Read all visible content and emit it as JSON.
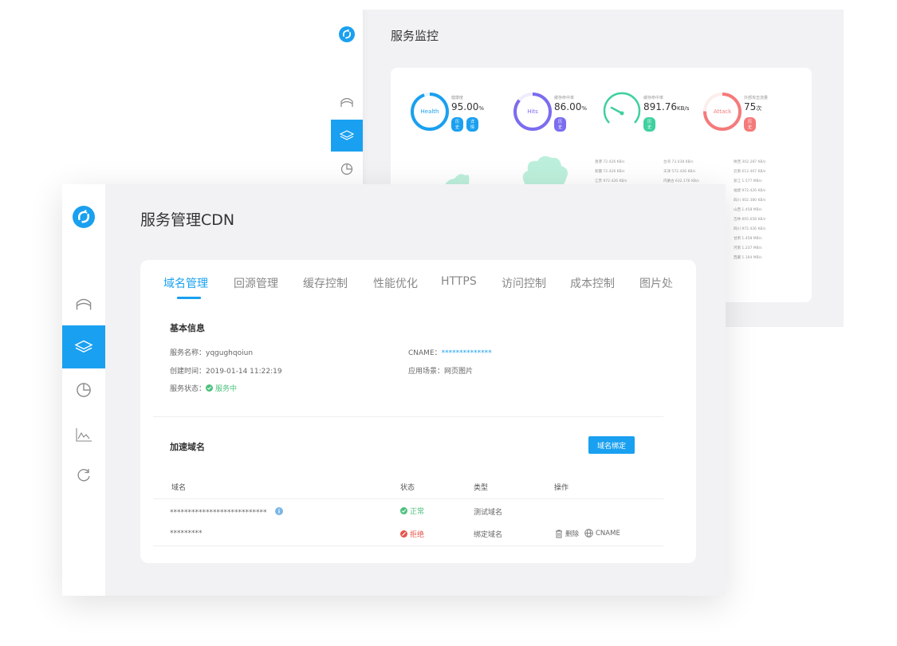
{
  "colors": {
    "accent": "#1aa0f0",
    "health": "#1aa0f0",
    "hits": "#7b6cf0",
    "speed": "#3fd0a0",
    "attack": "#f57a7a",
    "ok": "#4cc17d",
    "reject": "#e5564c"
  },
  "monitor": {
    "title": "服务监控",
    "metrics": [
      {
        "ring_label": "Health",
        "caption": "健康度",
        "value": "95.00",
        "unit": "%",
        "tags": [
          "历史",
          "详情"
        ]
      },
      {
        "ring_label": "Hits",
        "caption": "缓存命中率",
        "value": "86.00",
        "unit": "%",
        "tags": [
          "历史"
        ]
      },
      {
        "ring_label": "",
        "caption": "缓存命中率",
        "value": "891.76",
        "unit": "KB/s",
        "tags": [
          "历史"
        ]
      },
      {
        "ring_label": "Attack",
        "caption": "外部攻击流量",
        "value": "75",
        "unit": "次",
        "tags": [
          "历史"
        ]
      }
    ],
    "speeds_col1": [
      "香港 72.426 KB/s",
      "新疆 72.426 KB/s",
      "江苏 972.426 KB/s"
    ],
    "speeds_col2": [
      "台湾 73.038 KB/s",
      "天津 572.426 KB/s",
      "内蒙古 632.176 KB/s"
    ],
    "speeds_col3": [
      "陕西 302.287 KB/s",
      "云南 612.467 KB/s",
      "浙江 1.577 MB/s",
      "福建 972.426 KB/s",
      "四川 402.380 KB/s",
      "山西 1.458 MB/s",
      "吉林 605.658 KB/s",
      "四川 972.426 KB/s",
      "甘肃 1.458 MB/s",
      "河南 1.237 MB/s",
      "西藏 1.164 MB/s"
    ]
  },
  "cdn": {
    "title": "服务管理CDN",
    "tabs": [
      "域名管理",
      "回源管理",
      "缓存控制",
      "性能优化",
      "HTTPS",
      "访问控制",
      "成本控制",
      "图片处"
    ],
    "basic": {
      "title": "基本信息",
      "name_label": "服务名称：",
      "name_value": "yqgughqoiun",
      "created_label": "创建时间：",
      "created_value": "2019-01-14 11:22:19",
      "status_label": "服务状态：",
      "status_value": "服务中",
      "cname_label": "CNAME：",
      "cname_value": "**************",
      "scene_label": "应用场景：",
      "scene_value": "网页图片"
    },
    "domains": {
      "title": "加速域名",
      "bind_button": "域名绑定",
      "columns": [
        "域名",
        "状态",
        "类型",
        "操作"
      ],
      "rows": [
        {
          "domain": "***************************",
          "status": "正常",
          "type": "测试域名"
        },
        {
          "domain": "*********",
          "status": "拒绝",
          "type": "绑定域名",
          "delete": "删除",
          "cname": "CNAME"
        }
      ]
    }
  }
}
